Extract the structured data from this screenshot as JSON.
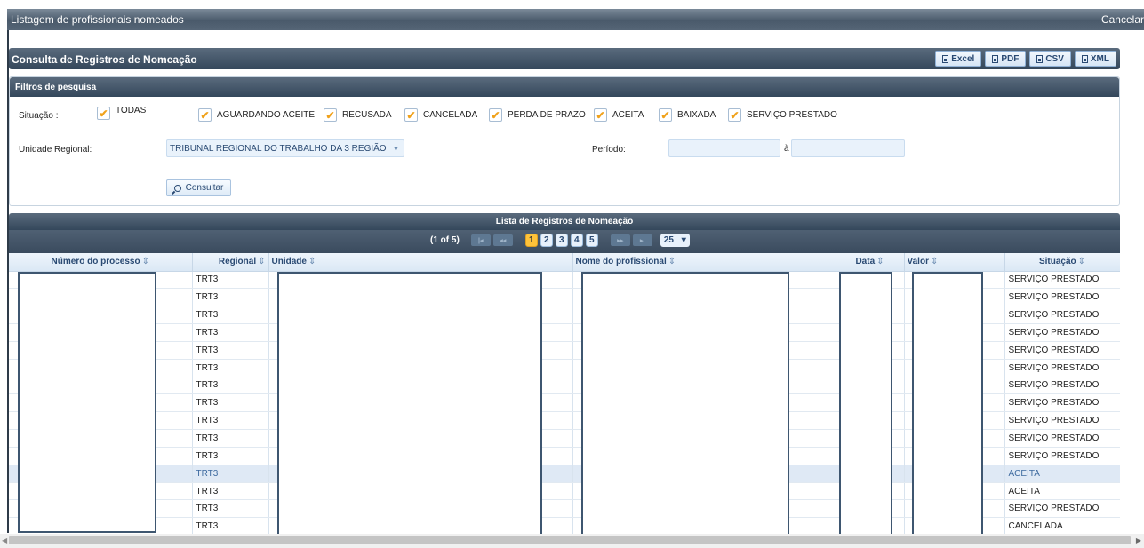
{
  "dialog": {
    "title": "Listagem de profissionais nomeados",
    "cancel_label": "Cancelar"
  },
  "panel": {
    "title": "Consulta de Registros de Nomeação",
    "exports": [
      {
        "label": "Excel",
        "icon": "excel-file-icon"
      },
      {
        "label": "PDF",
        "icon": "pdf-file-icon"
      },
      {
        "label": "CSV",
        "icon": "csv-file-icon"
      },
      {
        "label": "XML",
        "icon": "xml-file-icon"
      }
    ]
  },
  "filters": {
    "title": "Filtros de pesquisa",
    "situacao_label": "Situação :",
    "situacao_options": [
      {
        "label": "TODAS",
        "checked": true
      },
      {
        "label": "AGUARDANDO ACEITE",
        "checked": true
      },
      {
        "label": "RECUSADA",
        "checked": true
      },
      {
        "label": "CANCELADA",
        "checked": true
      },
      {
        "label": "PERDA DE PRAZO",
        "checked": true
      },
      {
        "label": "ACEITA",
        "checked": true
      },
      {
        "label": "BAIXADA",
        "checked": true
      },
      {
        "label": "SERVIÇO PRESTADO",
        "checked": true
      }
    ],
    "unidade_label": "Unidade Regional:",
    "unidade_value": "TRIBUNAL REGIONAL DO TRABALHO DA 3 REGIÃO",
    "periodo_label": "Período:",
    "periodo_separator": "à",
    "periodo_start": "",
    "periodo_end": "",
    "consult_label": "Consultar",
    "check_glyph": "✔"
  },
  "list": {
    "title": "Lista de Registros de Nomeação",
    "paginator": {
      "status": "(1 of 5)",
      "pages": [
        "1",
        "2",
        "3",
        "4",
        "5"
      ],
      "active_page": "1",
      "rows_per_page": "25",
      "nav": {
        "first": "|◂",
        "prev": "◂◂",
        "next": "▸▸",
        "last": "▸|"
      }
    },
    "columns": [
      {
        "label": "Número do processo",
        "sort": "⇕"
      },
      {
        "label": "Regional",
        "sort": "⇕"
      },
      {
        "label": "Unidade",
        "sort": "⇕"
      },
      {
        "label": "Nome do profissional",
        "sort": "⇕"
      },
      {
        "label": "Data",
        "sort": "⇕"
      },
      {
        "label": "Valor",
        "sort": "⇕"
      },
      {
        "label": "Situação",
        "sort": "⇕"
      }
    ],
    "rows": [
      {
        "regional": "TRT3",
        "situacao": "SERVIÇO PRESTADO"
      },
      {
        "regional": "TRT3",
        "situacao": "SERVIÇO PRESTADO"
      },
      {
        "regional": "TRT3",
        "situacao": "SERVIÇO PRESTADO"
      },
      {
        "regional": "TRT3",
        "situacao": "SERVIÇO PRESTADO"
      },
      {
        "regional": "TRT3",
        "situacao": "SERVIÇO PRESTADO"
      },
      {
        "regional": "TRT3",
        "situacao": "SERVIÇO PRESTADO"
      },
      {
        "regional": "TRT3",
        "situacao": "SERVIÇO PRESTADO"
      },
      {
        "regional": "TRT3",
        "situacao": "SERVIÇO PRESTADO"
      },
      {
        "regional": "TRT3",
        "situacao": "SERVIÇO PRESTADO"
      },
      {
        "regional": "TRT3",
        "situacao": "SERVIÇO PRESTADO"
      },
      {
        "regional": "TRT3",
        "situacao": "SERVIÇO PRESTADO"
      },
      {
        "regional": "TRT3",
        "situacao": "ACEITA",
        "highlight": true
      },
      {
        "regional": "TRT3",
        "situacao": "ACEITA"
      },
      {
        "regional": "TRT3",
        "situacao": "SERVIÇO PRESTADO"
      },
      {
        "regional": "TRT3",
        "situacao": "CANCELADA"
      }
    ]
  },
  "colors": {
    "header_dark": "#34475b",
    "accent_orange": "#f0a21c",
    "link_blue": "#2a4a73",
    "highlight_row": "#dfe9f5"
  }
}
